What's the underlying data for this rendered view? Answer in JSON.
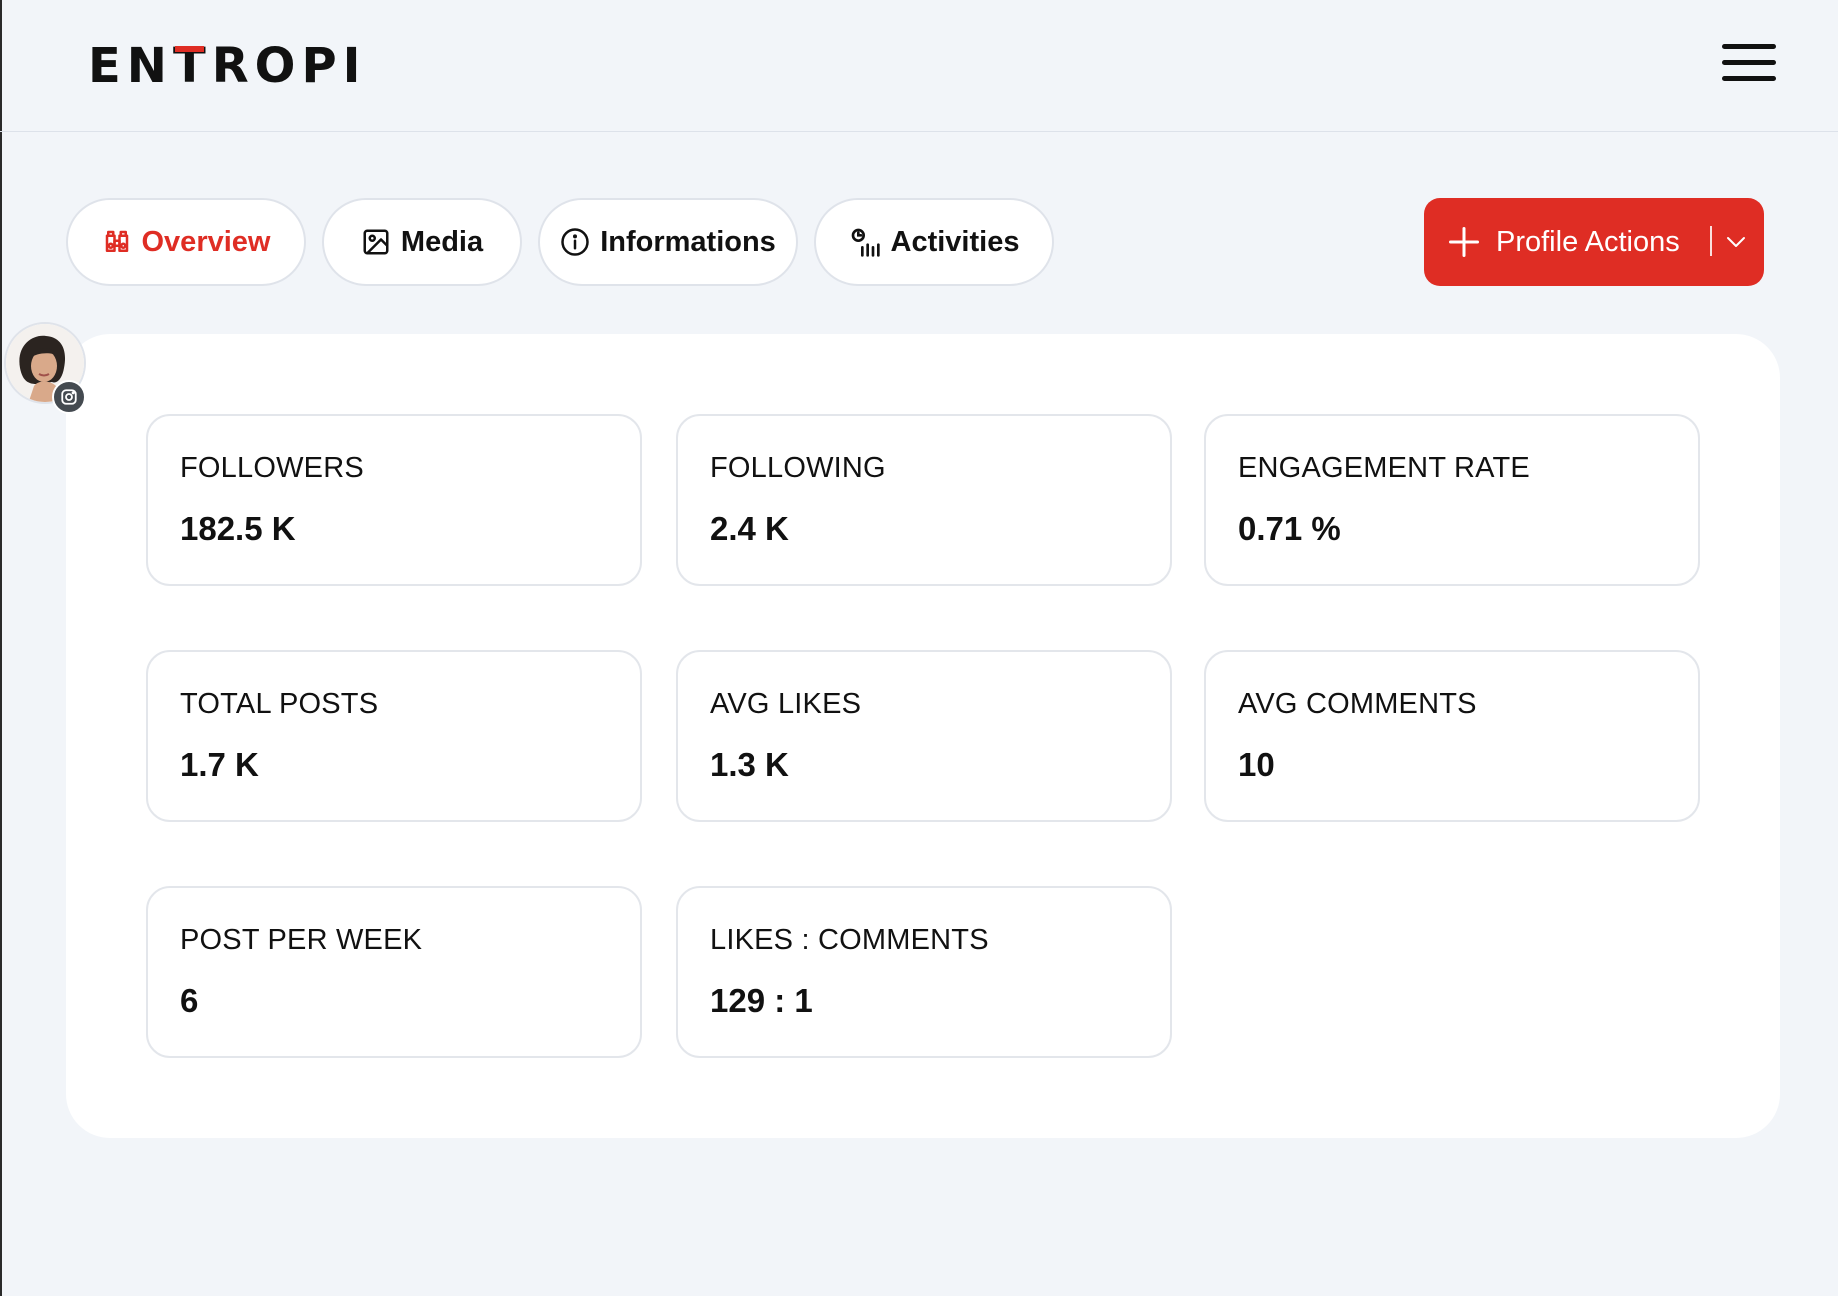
{
  "header": {
    "logo_parts": [
      "EN",
      "T",
      "ROPI"
    ],
    "menu_icon": "hamburger-menu-icon"
  },
  "tabs": [
    {
      "label": "Overview",
      "icon": "binoculars-icon",
      "active": true
    },
    {
      "label": "Media",
      "icon": "image-icon",
      "active": false
    },
    {
      "label": "Informations",
      "icon": "info-icon",
      "active": false
    },
    {
      "label": "Activities",
      "icon": "activity-chart-icon",
      "active": false
    }
  ],
  "profile_actions": {
    "label": "Profile Actions",
    "icon": "plus-icon",
    "dropdown_icon": "chevron-down-icon"
  },
  "profile": {
    "avatar": "avatar",
    "platform_icon": "instagram-icon"
  },
  "stats": [
    {
      "label": "FOLLOWERS",
      "value": "182.5 K"
    },
    {
      "label": "FOLLOWING",
      "value": "2.4 K"
    },
    {
      "label": "ENGAGEMENT RATE",
      "value": "0.71 %"
    },
    {
      "label": "TOTAL POSTS",
      "value": "1.7 K"
    },
    {
      "label": "AVG LIKES",
      "value": "1.3 K"
    },
    {
      "label": "AVG COMMENTS",
      "value": "10"
    },
    {
      "label": "POST PER WEEK",
      "value": "6"
    },
    {
      "label": "LIKES : COMMENTS",
      "value": "129 : 1"
    }
  ],
  "colors": {
    "accent": "#df2d24",
    "background": "#f2f5f9",
    "card": "#ffffff",
    "border": "#e3e6eb"
  }
}
